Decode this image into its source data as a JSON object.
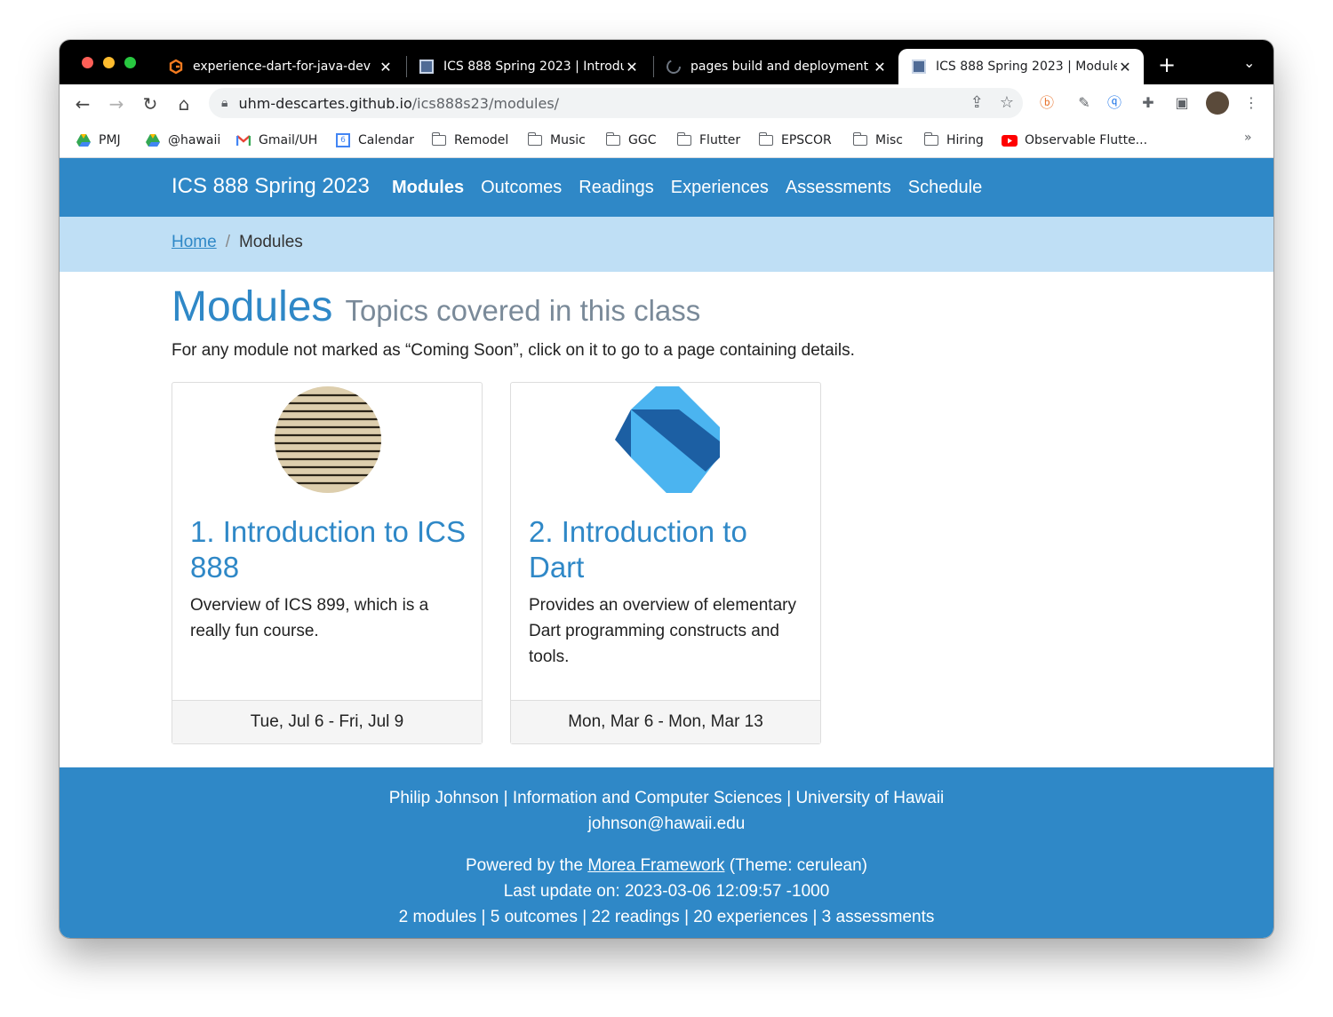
{
  "browser": {
    "tabs": [
      {
        "title": "experience-dart-for-java-dev",
        "icon": "gitbook-icon",
        "active": false
      },
      {
        "title": "ICS 888 Spring 2023 | Introdu",
        "icon": "page-icon",
        "active": false
      },
      {
        "title": "pages build and deployment ·",
        "icon": "github-icon",
        "active": false
      },
      {
        "title": "ICS 888 Spring 2023 | Module",
        "icon": "page-icon",
        "active": true
      }
    ],
    "new_tab": "+",
    "url_host": "uhm-descartes.github.io",
    "url_path": "/ics888s23/modules/",
    "bookmarks": [
      {
        "label": "PMJ",
        "icon": "drive-icon"
      },
      {
        "label": "@hawaii",
        "icon": "drive-icon"
      },
      {
        "label": "Gmail/UH",
        "icon": "gmail-icon"
      },
      {
        "label": "Calendar",
        "icon": "calendar-icon"
      },
      {
        "label": "Remodel",
        "icon": "folder-icon"
      },
      {
        "label": "Music",
        "icon": "folder-icon"
      },
      {
        "label": "GGC",
        "icon": "folder-icon"
      },
      {
        "label": "Flutter",
        "icon": "folder-icon"
      },
      {
        "label": "EPSCOR",
        "icon": "folder-icon"
      },
      {
        "label": "Misc",
        "icon": "folder-icon"
      },
      {
        "label": "Hiring",
        "icon": "folder-icon"
      },
      {
        "label": "Observable Flutte...",
        "icon": "youtube-icon"
      }
    ],
    "bookmarks_more": "»",
    "calendar_day": "6"
  },
  "site": {
    "brand": "ICS 888 Spring 2023",
    "nav": [
      {
        "label": "Modules",
        "active": true
      },
      {
        "label": "Outcomes",
        "active": false
      },
      {
        "label": "Readings",
        "active": false
      },
      {
        "label": "Experiences",
        "active": false
      },
      {
        "label": "Assessments",
        "active": false
      },
      {
        "label": "Schedule",
        "active": false
      }
    ],
    "breadcrumb": {
      "home": "Home",
      "separator": "/",
      "current": "Modules"
    }
  },
  "main": {
    "title": "Modules",
    "subtitle": "Topics covered in this class",
    "lead": "For any module not marked as “Coming Soon”, click on it to go to a page containing details.",
    "modules": [
      {
        "title": "1. Introduction to ICS 888",
        "description": "Overview of ICS 899, which is a really fun course.",
        "dates": "Tue, Jul 6 - Fri, Jul 9",
        "image": "dictionary-introduction-image"
      },
      {
        "title": "2. Introduction to Dart",
        "description": "Provides an overview of elementary Dart programming constructs and tools.",
        "dates": "Mon, Mar 6 - Mon, Mar 13",
        "image": "dart-logo-image"
      }
    ]
  },
  "footer": {
    "author": "Philip Johnson",
    "department": "Information and Computer Sciences",
    "university": "University of Hawaii",
    "email": "johnson@hawaii.edu",
    "powered_prefix": "Powered by the",
    "framework": "Morea Framework",
    "theme": "(Theme: cerulean)",
    "last_update": "Last update on: 2023-03-06 12:09:57 -1000",
    "counts": [
      "2 modules",
      "5 outcomes",
      "22 readings",
      "20 experiences",
      "3 assessments"
    ],
    "separator": "|"
  },
  "colors": {
    "primary": "#2f88c7",
    "breadcrumb_bg": "#bfdff5",
    "subtitle": "#7a8a99"
  }
}
